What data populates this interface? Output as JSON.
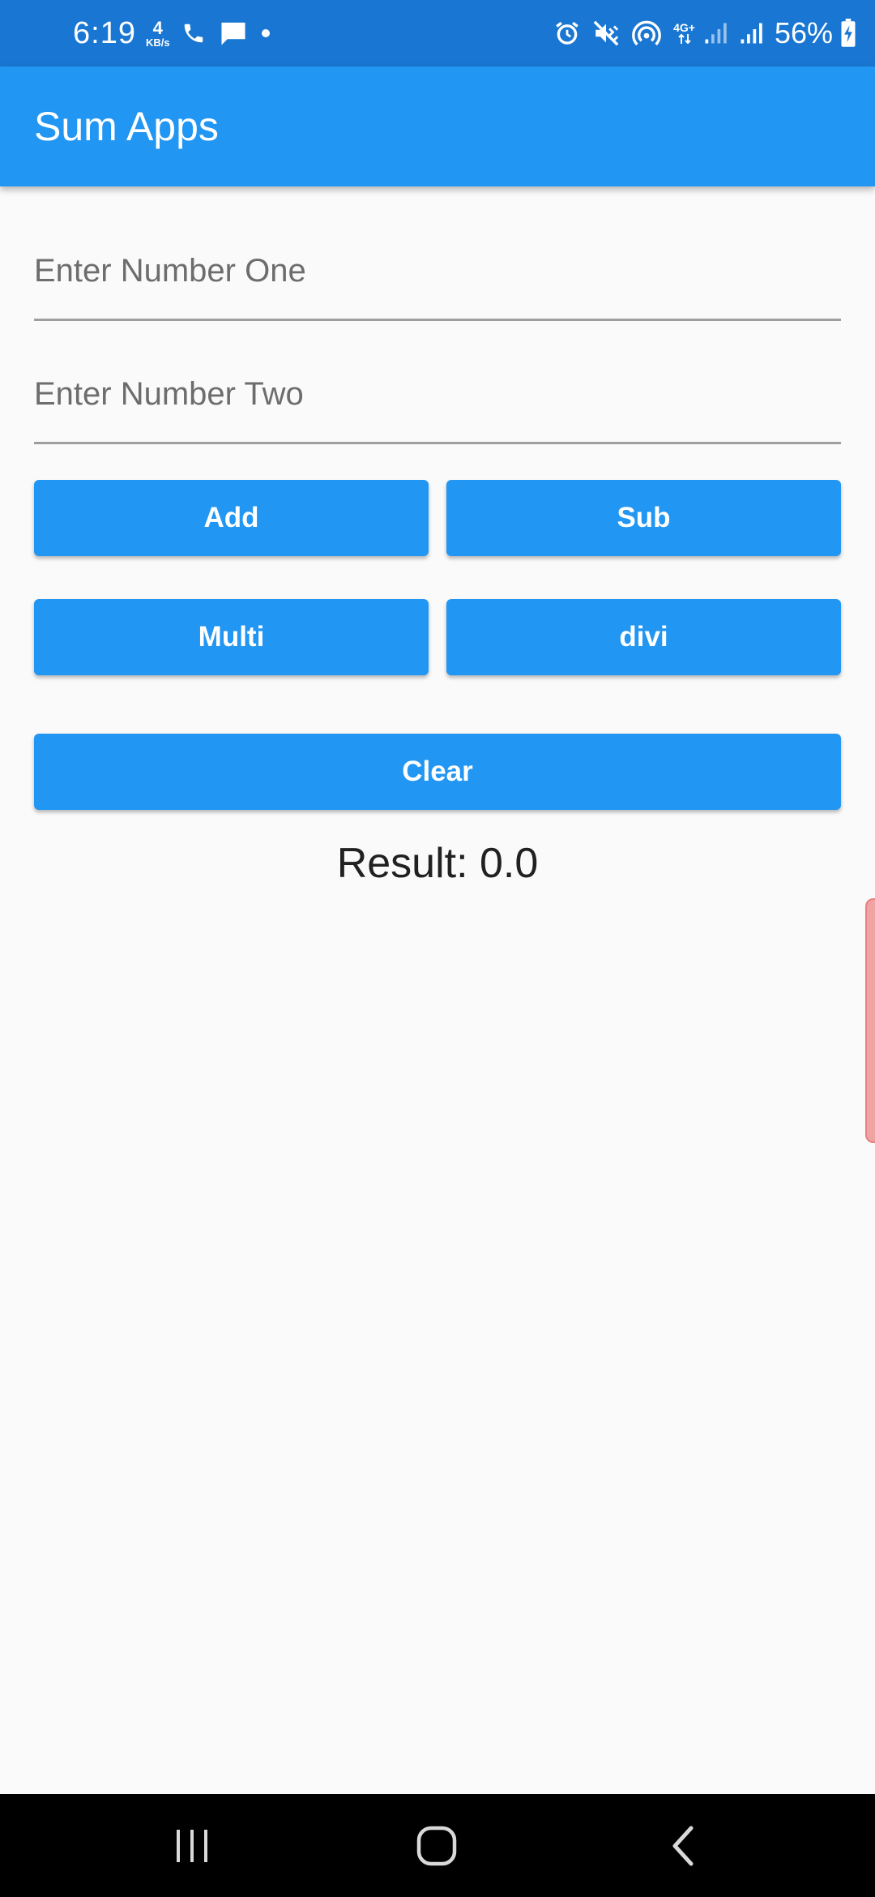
{
  "status_bar": {
    "time": "6:19",
    "net_speed_value": "4",
    "net_speed_unit": "KB/s",
    "network_type": "4G+",
    "battery_percent": "56%",
    "left_icons": [
      "phone-icon",
      "message-icon",
      "dot-icon"
    ],
    "right_icons": [
      "alarm-icon",
      "mute-icon",
      "hotspot-icon",
      "signal-icon",
      "signal-icon",
      "battery-charging-icon"
    ]
  },
  "app_bar": {
    "title": "Sum Apps"
  },
  "form": {
    "number_one_placeholder": "Enter Number One",
    "number_one_value": "",
    "number_two_placeholder": "Enter Number Two",
    "number_two_value": ""
  },
  "buttons": {
    "add_label": "Add",
    "sub_label": "Sub",
    "multi_label": "Multi",
    "divi_label": "divi",
    "clear_label": "Clear"
  },
  "result": {
    "text": "Result: 0.0"
  },
  "nav_bar": {
    "icons": [
      "recent-apps-icon",
      "home-icon",
      "back-icon"
    ]
  },
  "colors": {
    "status_bar": "#1976d2",
    "primary": "#2196f3",
    "background": "#fafafa",
    "nav_bar": "#000000"
  }
}
